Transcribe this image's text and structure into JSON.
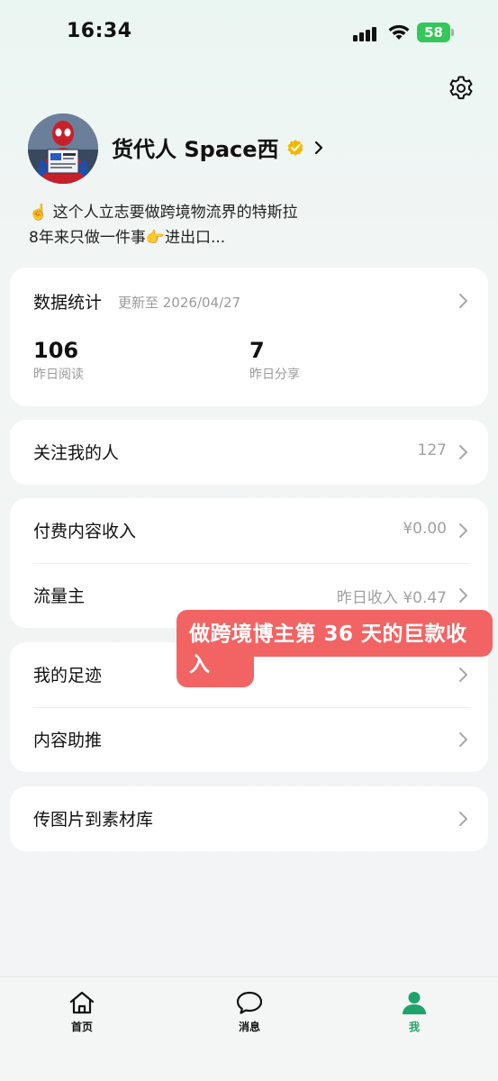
{
  "status_bar": {
    "time": "16:34",
    "battery": "58"
  },
  "profile": {
    "name": "货代人 Space西",
    "bio_line1": "☝️ 这个人立志要做跨境物流界的特斯拉",
    "bio_line2": "8年来只做一件事👉进出口..."
  },
  "stats": {
    "title": "数据统计",
    "updated": "更新至 2026/04/27",
    "items": [
      {
        "value": "106",
        "label": "昨日阅读"
      },
      {
        "value": "7",
        "label": "昨日分享"
      }
    ]
  },
  "menu": {
    "followers": {
      "label": "关注我的人",
      "value": "127"
    },
    "paid_income": {
      "label": "付费内容收入",
      "value": "¥0.00"
    },
    "traffic": {
      "label": "流量主",
      "value": "昨日收入 ¥0.47"
    },
    "footprint": {
      "label": "我的足迹"
    },
    "promote": {
      "label": "内容助推"
    },
    "upload": {
      "label": "传图片到素材库"
    }
  },
  "overlay": {
    "text": "做跨境博主第 36 天的巨款收入"
  },
  "tab_bar": {
    "tabs": [
      {
        "label": "首页",
        "icon": "home-icon"
      },
      {
        "label": "消息",
        "icon": "message-icon"
      },
      {
        "label": "我",
        "icon": "person-icon"
      }
    ]
  },
  "colors": {
    "accent_green": "#1fa36a",
    "battery_green": "#34c759",
    "verify_gold": "#f5b800",
    "overlay_red": "#f26464"
  }
}
